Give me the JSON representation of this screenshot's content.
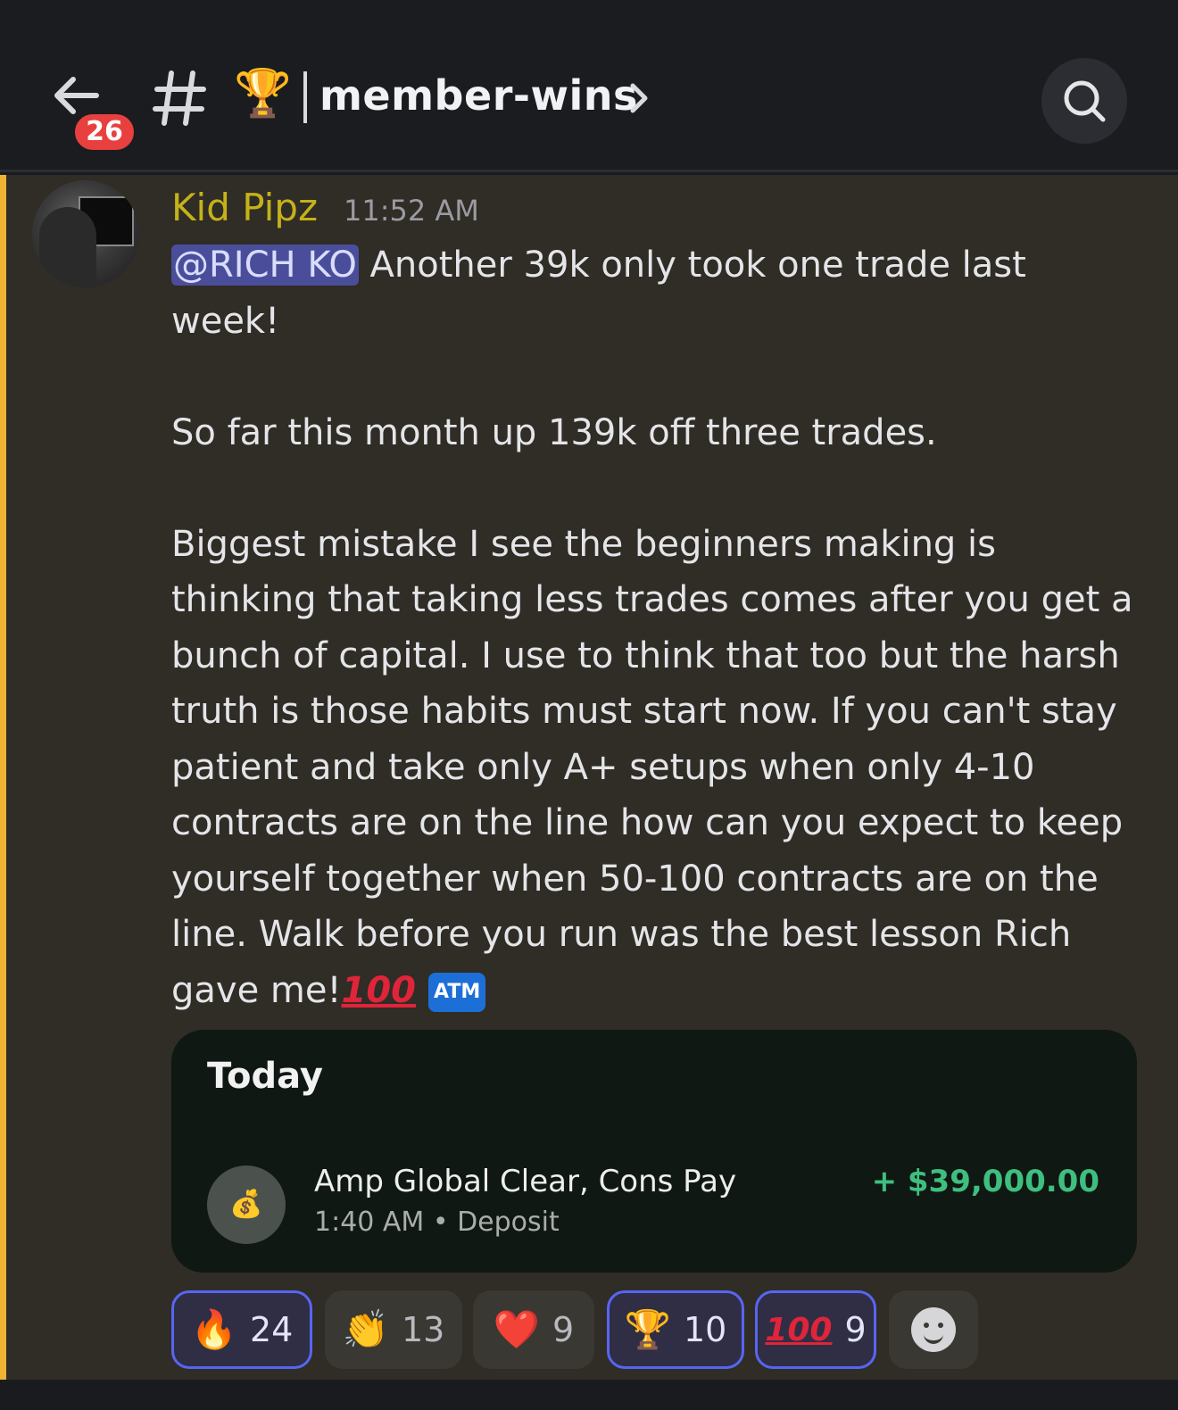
{
  "header": {
    "unread_badge": "26",
    "channel_emoji": "🏆",
    "channel_name": "member-wins"
  },
  "message": {
    "author": "Kid Pipz",
    "time": "11:52 AM",
    "mention": "@RICH KO",
    "text_main": " Another 39k only took one trade last week!\n\nSo far this month up 139k off three trades.\n\nBiggest mistake I see the beginners making is thinking that taking less trades comes after you get a bunch of capital. I use to think that too but the harsh truth is those habits must start now. If you can't stay patient and take only A+ setups when only 4-10 contracts are on the line how can you expect to keep yourself together when 50-100 contracts are on the line. Walk before you run was the best lesson Rich gave me!",
    "emoji_100": "100",
    "emoji_atm": "ATM"
  },
  "card": {
    "title": "Today",
    "coin_icon": "💰",
    "payee": "Amp Global Clear, Cons Pay",
    "subtitle": "1:40 AM • Deposit",
    "amount": "+ $39,000.00"
  },
  "reactions": [
    {
      "emoji": "🔥",
      "count": "24",
      "me": true
    },
    {
      "emoji": "👏",
      "count": "13",
      "me": false
    },
    {
      "emoji": "❤️",
      "count": "9",
      "me": false
    },
    {
      "emoji": "🏆",
      "count": "10",
      "me": true
    },
    {
      "emoji": "100",
      "count": "9",
      "me": true
    }
  ],
  "colors": {
    "accent_bar": "#f0b232",
    "username": "#c4b21a",
    "amount": "#3fbf7f",
    "badge": "#e8403f"
  }
}
